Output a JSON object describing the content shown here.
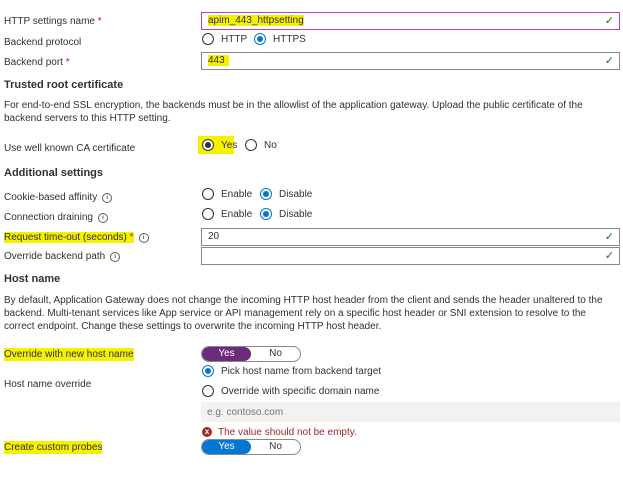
{
  "http_settings_name": {
    "label": "HTTP settings name",
    "required_mark": "*",
    "value": "apim_443_httpsetting"
  },
  "backend_protocol": {
    "label": "Backend protocol",
    "options": [
      "HTTP",
      "HTTPS"
    ],
    "selected": "HTTPS"
  },
  "backend_port": {
    "label": "Backend port",
    "required_mark": "*",
    "value": "443"
  },
  "trusted_root": {
    "heading": "Trusted root certificate",
    "description": "For end-to-end SSL encryption, the backends must be in the allowlist of the application gateway. Upload the public certificate of the backend servers to this HTTP setting.",
    "ca_label": "Use well known CA certificate",
    "ca_options": [
      "Yes",
      "No"
    ],
    "ca_selected": "Yes"
  },
  "additional": {
    "heading": "Additional settings",
    "cookie_affinity": {
      "label": "Cookie-based affinity",
      "info": "i",
      "options": [
        "Enable",
        "Disable"
      ],
      "selected": "Disable"
    },
    "connection_draining": {
      "label": "Connection draining",
      "info": "i",
      "options": [
        "Enable",
        "Disable"
      ],
      "selected": "Disable"
    },
    "request_timeout": {
      "label": "Request time-out (seconds)",
      "required_mark": "*",
      "info": "i",
      "value": "20"
    },
    "override_path": {
      "label": "Override backend path",
      "info": "i",
      "value": ""
    }
  },
  "host_name": {
    "heading": "Host name",
    "description": "By default, Application Gateway does not change the incoming HTTP host header from the client and sends the header unaltered to the backend. Multi-tenant services like App service or API management rely on a specific host header or SNI extension to resolve to the correct endpoint. Change these settings to overwrite the incoming HTTP host header.",
    "override_label": "Override with new host name",
    "override_toggle": {
      "yes": "Yes",
      "no": "No",
      "selected": "Yes"
    },
    "host_override_label": "Host name override",
    "host_options": [
      "Pick host name from backend target",
      "Override with specific domain name"
    ],
    "host_selected": "Pick host name from backend target",
    "domain_placeholder": "e.g. contoso.com",
    "error_text": "The value should not be empty.",
    "error_icon": "x"
  },
  "custom_probes": {
    "label": "Create custom probes",
    "toggle": {
      "yes": "Yes",
      "no": "No",
      "selected": "Yes"
    }
  },
  "colors": {
    "highlight": "#f5f100",
    "accent_blue": "#0078d4",
    "purple": "#6b2a7a",
    "error": "#a4262c",
    "valid_green": "#107c10"
  },
  "icons": {
    "valid": "check-icon",
    "info": "info-icon",
    "error": "error-circle-icon"
  }
}
